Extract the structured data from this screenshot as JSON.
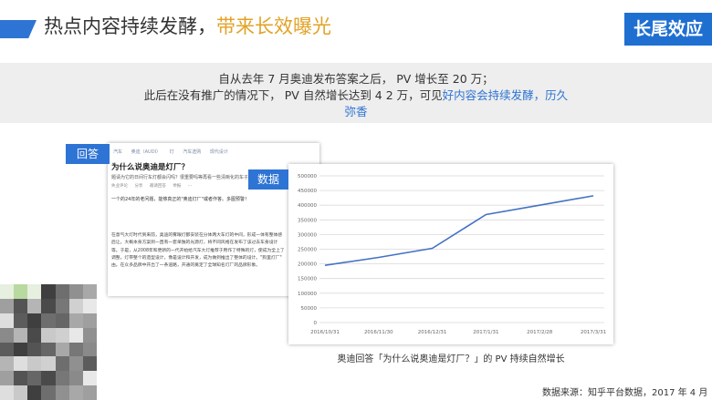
{
  "header": {
    "title_main": "热点内容持续发酵，",
    "title_highlight": "带来长效曝光",
    "badge": "长尾效应"
  },
  "summary": {
    "line1": "自从去年 7 月奥迪发布答案之后， PV 增长至 20 万；",
    "line2_a": "此后在没有推广的情况下， PV 自然增长达到 4 2 万，可见",
    "line2_b": "好内容会持续发酵，历久",
    "line3": "弥香"
  },
  "labels": {
    "answer": "回答",
    "data": "数据"
  },
  "answer_card": {
    "tags": [
      "汽车",
      "奥迪（AUDI）",
      "灯",
      "汽车选购",
      "现代设计"
    ],
    "question": "为什么说奥迪是灯厂？",
    "description": "题请为它的日间行车灯都会闪吗？很重要吗等再看一些清晰化的车子详情",
    "actions": [
      "失业评论",
      "分享",
      "邀请回答",
      "举报",
      "···"
    ],
    "answer_intro": "一个的24年的老问题，能够真正的\"奥迪灯厂\"或者作答。多图预警！",
    "paragraph": [
      "在意气大灯时代到来前，奥迪的雾眼灯都安装在分体两大车灯的中间，形成一体有整体感",
      "后让。大概本身方案到一直有一套单独的光源灯，将不同风格在发布了该过去车身设计",
      "等。于是，从2008年和更新的一代开始给汽车大灯推荐于用作了特殊的灯，使成为全上了",
      "调整。灯带整个的造型设计，像是设计和开发，成为做到推出了整体的设计。\"狗里灯厂\"",
      "由。在众多品牌中开出了一条道路，开通的奠定了全球知名灯厂的品牌形象。"
    ]
  },
  "chart_data": {
    "type": "line",
    "title": "",
    "xlabel": "",
    "ylabel": "",
    "categories": [
      "2016/10/31",
      "2016/11/30",
      "2016/12/31",
      "2017/1/31",
      "2017/2/28",
      "2017/3/31"
    ],
    "y_ticks": [
      0,
      50000,
      100000,
      150000,
      200000,
      250000,
      300000,
      350000,
      400000,
      450000,
      500000
    ],
    "ylim": [
      0,
      500000
    ],
    "series": [
      {
        "values": [
          195000,
          222000,
          253000,
          368000,
          400000,
          432000
        ]
      }
    ],
    "grid": true,
    "color": "#4472c4"
  },
  "caption": "奥迪回答「为什么说奥迪是灯厂？」的 PV 持续自然增长",
  "source": "数据来源：知乎平台数据，2017 年 4 月"
}
